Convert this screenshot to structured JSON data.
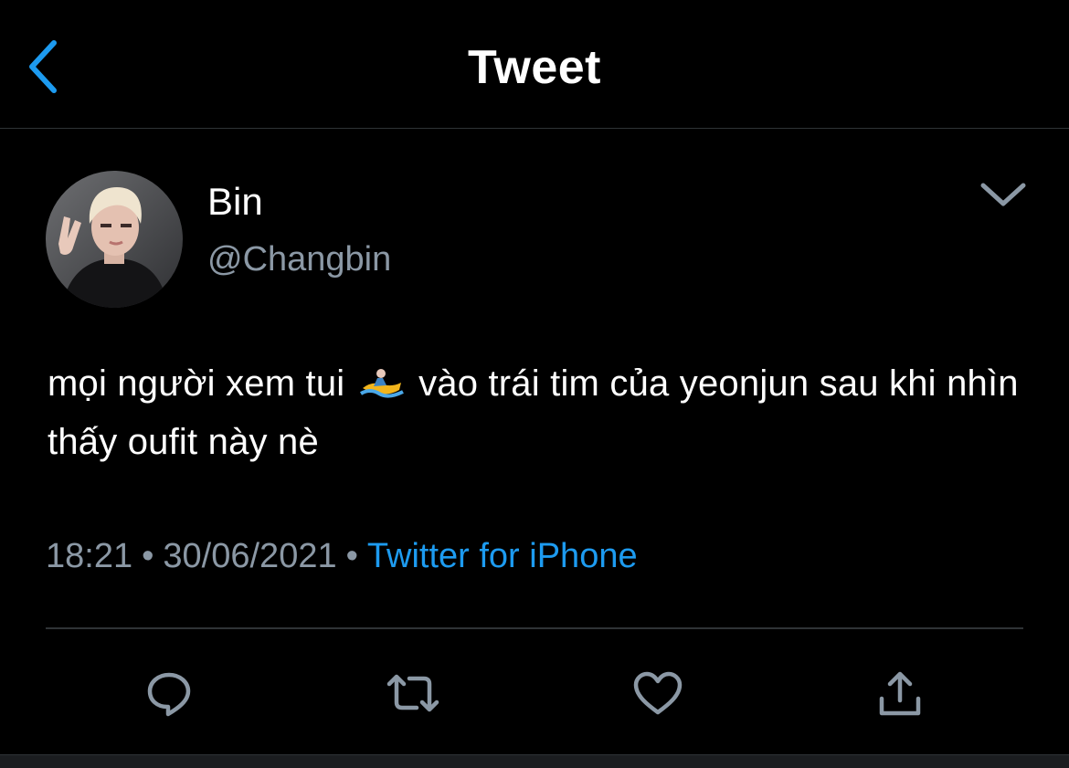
{
  "header": {
    "title": "Tweet",
    "back_icon": "chevron-left-icon"
  },
  "tweet": {
    "display_name": "Bin",
    "handle": "@Changbin",
    "text_before_emoji": "mọi người xem tui",
    "emoji": "surfing-emoji",
    "text_after_emoji": "vào trái tim của yeonjun sau khi nhìn thấy oufit này nè",
    "time": "18:21",
    "date": "30/06/2021",
    "separator": "•",
    "source": "Twitter for iPhone"
  },
  "actions": {
    "reply_icon": "reply-icon",
    "retweet_icon": "retweet-icon",
    "like_icon": "heart-icon",
    "share_icon": "share-icon"
  },
  "colors": {
    "background": "#000000",
    "text_primary": "#ffffff",
    "text_secondary": "#8b98a5",
    "accent": "#1d9bf0",
    "divider": "#2f3336"
  }
}
